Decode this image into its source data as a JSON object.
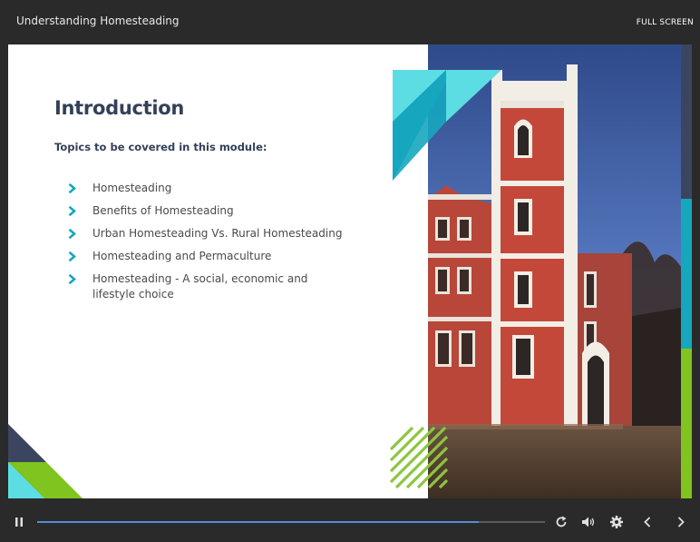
{
  "player": {
    "course_title": "Understanding Homesteading",
    "fullscreen_label": "FULL SCREEN",
    "progress": 0.87
  },
  "slide": {
    "heading": "Introduction",
    "subtitle": "Topics to be covered in this module:",
    "topics": [
      "Homesteading",
      "Benefits of Homesteading",
      "Urban Homesteading Vs. Rural Homesteading",
      "Homesteading and Permaculture",
      "Homesteading - A social, economic and lifestyle choice"
    ]
  },
  "colors": {
    "heading": "#34405a",
    "accent_teal": "#16a7bf",
    "accent_light_teal": "#5cdde3",
    "accent_green": "#8cc63f",
    "progress_fill": "#4f8fd6",
    "bar_bg": "#2a2a2a"
  },
  "icons": {
    "pause": "pause-icon",
    "replay": "replay-icon",
    "volume": "volume-icon",
    "settings": "gear-icon",
    "prev": "chevron-left-icon",
    "next": "chevron-right-icon",
    "bullet": "chevron-right-icon"
  }
}
